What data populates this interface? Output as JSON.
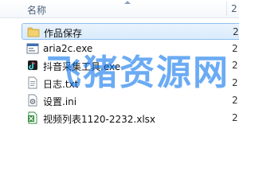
{
  "columns": {
    "name": "名称",
    "date": "2"
  },
  "files": [
    {
      "name": "作品保存",
      "date": "2",
      "icon": "folder-icon",
      "selected": true
    },
    {
      "name": "aria2c.exe",
      "date": "2",
      "icon": "exe-icon",
      "selected": false
    },
    {
      "name": "抖音采集工具.exe",
      "date": "2",
      "icon": "app-icon",
      "selected": false
    },
    {
      "name": "日志.txt",
      "date": "2",
      "icon": "text-file-icon",
      "selected": false
    },
    {
      "name": "设置.ini",
      "date": "2",
      "icon": "settings-file-icon",
      "selected": false
    },
    {
      "name": "视频列表1120-2232.xlsx",
      "date": "2",
      "icon": "excel-file-icon",
      "selected": false
    }
  ],
  "watermark": "飞猪资源网",
  "colors": {
    "selection": "#d9ebfc",
    "selection_border": "#8fc0ee",
    "folder": "#e8c15a",
    "excel": "#2e8b3a",
    "watermark": "#006eeb"
  }
}
